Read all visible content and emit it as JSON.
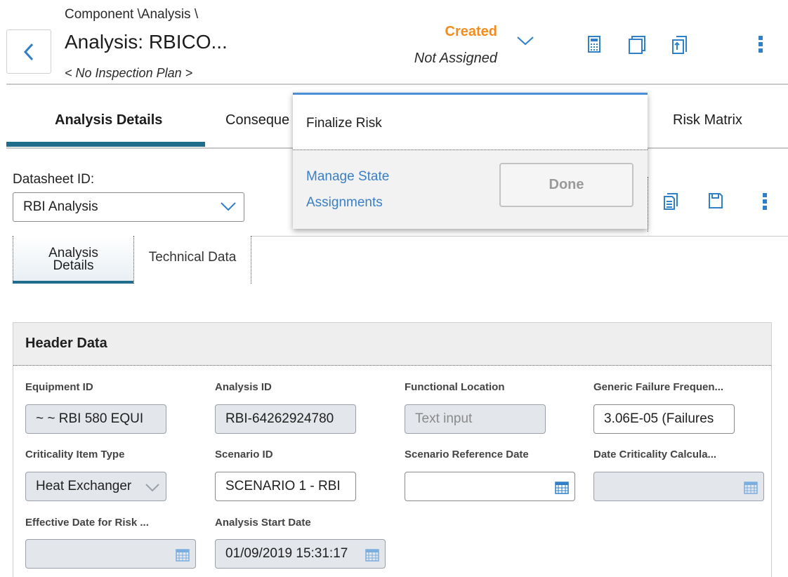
{
  "header": {
    "breadcrumb": "Component \\Analysis \\",
    "title": "Analysis: RBICO...",
    "subtitle": "< No Inspection Plan >",
    "state": "Created",
    "assignment": "Not Assigned"
  },
  "tabs": {
    "analysis_details": "Analysis Details",
    "consequence": "Conseque",
    "risk_matrix": "Risk Matrix"
  },
  "datasheet": {
    "label": "Datasheet ID:",
    "value": "RBI Analysis"
  },
  "subtabs": {
    "analysis_details_line1": "Analysis",
    "analysis_details_line2": "Details",
    "technical_data": "Technical Data"
  },
  "panel": {
    "title": "Header Data",
    "fields": {
      "equipment_id": {
        "label": "Equipment ID",
        "value": "~ ~ RBI 580 EQUI"
      },
      "analysis_id": {
        "label": "Analysis ID",
        "value": "RBI-64262924780"
      },
      "functional_location": {
        "label": "Functional Location",
        "placeholder": "Text input"
      },
      "generic_failure_frequency": {
        "label": "Generic Failure Frequen...",
        "value": "3.06E-05 (Failures"
      },
      "criticality_item_type": {
        "label": "Criticality Item Type",
        "value": "Heat Exchanger"
      },
      "scenario_id": {
        "label": "Scenario ID",
        "value": "SCENARIO 1 - RBI"
      },
      "scenario_reference_date": {
        "label": "Scenario Reference Date",
        "value": ""
      },
      "date_criticality_calculated": {
        "label": "Date Criticality Calcula...",
        "value": ""
      },
      "effective_date_for_risk": {
        "label": "Effective Date for Risk ...",
        "value": ""
      },
      "analysis_start_date": {
        "label": "Analysis Start Date",
        "value": "01/09/2019 15:31:17"
      }
    }
  },
  "popup": {
    "title": "Finalize Risk",
    "link_line1": "Manage State",
    "link_line2": "Assignments",
    "done": "Done"
  },
  "colors": {
    "state": "#f28c1c",
    "accent": "#1f6d8a",
    "link": "#3a7fc4",
    "popup_border": "#4a90d9"
  },
  "icons": [
    "chevron-left-icon",
    "chevron-down-icon",
    "calculator-icon",
    "copy-icon",
    "report-icon",
    "kebab-menu-icon",
    "document-icon",
    "save-icon",
    "calendar-icon"
  ]
}
